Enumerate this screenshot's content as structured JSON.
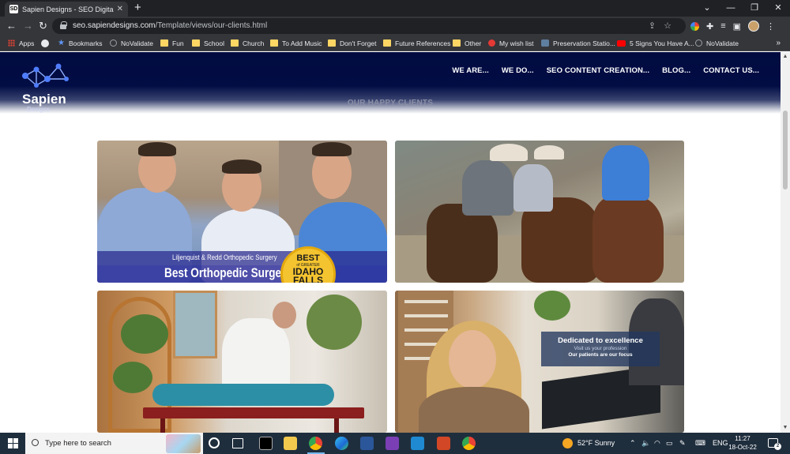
{
  "browser": {
    "tab_title": "Sapien Designs - SEO Digital Ma",
    "tab_favicon": "SD",
    "new_tab_symbol": "+",
    "url_host": "seo.sapiendesigns.com",
    "url_path": "/Template/views/our-clients.html",
    "bookmarks": [
      {
        "label": "Apps",
        "icon": "apps-grid-icon"
      },
      {
        "label": "",
        "icon": "github-icon"
      },
      {
        "label": "Bookmarks",
        "icon": "star-icon"
      },
      {
        "label": "NoValidate",
        "icon": "globe-icon"
      },
      {
        "label": "Fun",
        "icon": "folder-icon"
      },
      {
        "label": "School",
        "icon": "folder-icon"
      },
      {
        "label": "Church",
        "icon": "folder-icon"
      },
      {
        "label": "To Add Music",
        "icon": "folder-icon"
      },
      {
        "label": "Don't Forget",
        "icon": "folder-icon"
      },
      {
        "label": "Future References",
        "icon": "folder-icon"
      },
      {
        "label": "Other",
        "icon": "folder-icon"
      },
      {
        "label": "My wish list",
        "icon": "pinwheel-icon"
      },
      {
        "label": "Preservation Statio...",
        "icon": "site-icon"
      },
      {
        "label": "5 Signs You Have A...",
        "icon": "youtube-icon"
      },
      {
        "label": "NoValidate",
        "icon": "globe-icon"
      }
    ],
    "more_bookmarks": "»"
  },
  "site": {
    "logo_text": "Sapien",
    "logo_sub": "Designs",
    "nav": [
      "WE ARE...",
      "WE DO...",
      "SEO CONTENT CREATION...",
      "BLOG...",
      "CONTACT US..."
    ],
    "section_title": "OUR HAPPY CLIENTS",
    "cards": [
      {
        "banner_sub": "Liljenquist & Redd Orthopedic Surgery",
        "banner_main": "Best Orthopedic Surgeon",
        "badge_best": "BEST",
        "badge_of": "of GREATER",
        "badge_city1": "IDAHO",
        "badge_city2": "FALLS"
      },
      {},
      {},
      {
        "title": "Dedicated to excellence",
        "subtitle": "Visit us your profession",
        "tagline": "Our patients are our focus"
      }
    ]
  },
  "taskbar": {
    "search_placeholder": "Type here to search",
    "weather": "52°F  Sunny",
    "language": "ENG",
    "time": "11:27",
    "date": "18-Oct-22",
    "notifications": "2"
  },
  "colors": {
    "header_navy": "#020d45",
    "banner_blue": "#2a2a8c",
    "badge_gold": "#f4c430",
    "taskbar": "#1f2e3d"
  }
}
